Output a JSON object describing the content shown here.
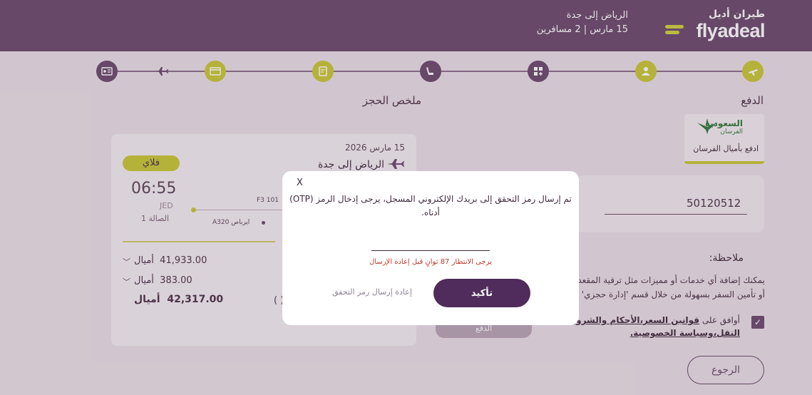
{
  "header": {
    "logo_ar": "طيران أديل",
    "logo_en": "flyadeal",
    "route": "الرياض إلى جدة",
    "trip_info": "15 مارس | 2 مسافرين",
    "brand_color": "#6a4a6c",
    "accent_color": "#c7c935"
  },
  "steps": [
    {
      "icon": "plane-icon",
      "state": "done"
    },
    {
      "icon": "passenger-icon",
      "state": "done"
    },
    {
      "icon": "extras-icon",
      "state": "active"
    },
    {
      "icon": "seat-icon",
      "state": "active"
    },
    {
      "icon": "ticket-icon",
      "state": "done"
    },
    {
      "icon": "card-icon",
      "state": "done"
    },
    {
      "icon": "plane-icon",
      "state": "plain"
    },
    {
      "icon": "boarding-pass-icon",
      "state": "active"
    }
  ],
  "payment": {
    "title": "الدفع",
    "alfursan_brand": "السعودية",
    "alfursan_sub": "الفرسان",
    "alfursan_label": "ادفع بأميال الفرسان",
    "member_number": "50120512",
    "note_title": "ملاحظة:",
    "note_line1": "يمكنك إضافة أي خدمات أو مميزات مثل ترقية المقعد",
    "note_line2": "أو تأمين السفر بسهولة من خلال قسم 'إدارة حجزي'",
    "agree_prefix": "أوافق على",
    "agree_link1": "قوانين السعر،الأحكام والشروط",
    "agree_link2": "النقل،وسياسة الخصوصية.",
    "pay_label": "الدفع",
    "back_label": "الرجوع"
  },
  "summary": {
    "title": "ملخص الحجز",
    "date": "15 مارس 2026",
    "route": "الرياض  إلى  جدة",
    "badge": "فلاي",
    "arrival_time": "06:55",
    "arrival_code": "JED",
    "terminal": "الصالة 1",
    "flight": "F3 101",
    "aircraft": "ايرباص A320",
    "rows": [
      {
        "label": "أميال",
        "value": "41,933.00"
      },
      {
        "label": "أميال",
        "value": "383.00"
      },
      {
        "label": "أميال",
        "value": "42,317.00"
      }
    ],
    "hidden_text": "( )"
  },
  "modal": {
    "close": "X",
    "message": "تم إرسال رمز التحقق إلى بريدك الإلكتروني المسجل، يرجى إدخال الرمز (OTP) أدناه.",
    "otp_value": "",
    "wait_text": "يرجى الانتظار 87 ثوانٍ قبل إعادة الإرسال",
    "confirm_label": "تأكيد",
    "resend_label": "إعادة إرسال رمز التحقق"
  }
}
